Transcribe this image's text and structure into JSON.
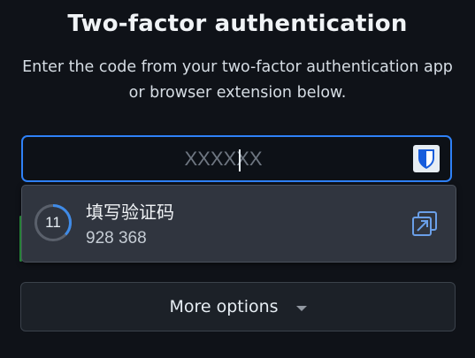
{
  "header": {
    "title": "Two-factor authentication",
    "subtitle_line1": "Enter the code from your two-factor authentication app",
    "subtitle_line2": "or browser extension below."
  },
  "code_input": {
    "placeholder": "XXXXXX",
    "value": ""
  },
  "autofill": {
    "timer_seconds": "11",
    "timer_progress": 0.37,
    "item_title": "填写验证码",
    "item_code": "928 368"
  },
  "more_options": {
    "label": "More options"
  },
  "colors": {
    "accent": "#2f81f7",
    "bitwarden": "#175ddc",
    "fill_icon": "#6a9fe8"
  }
}
